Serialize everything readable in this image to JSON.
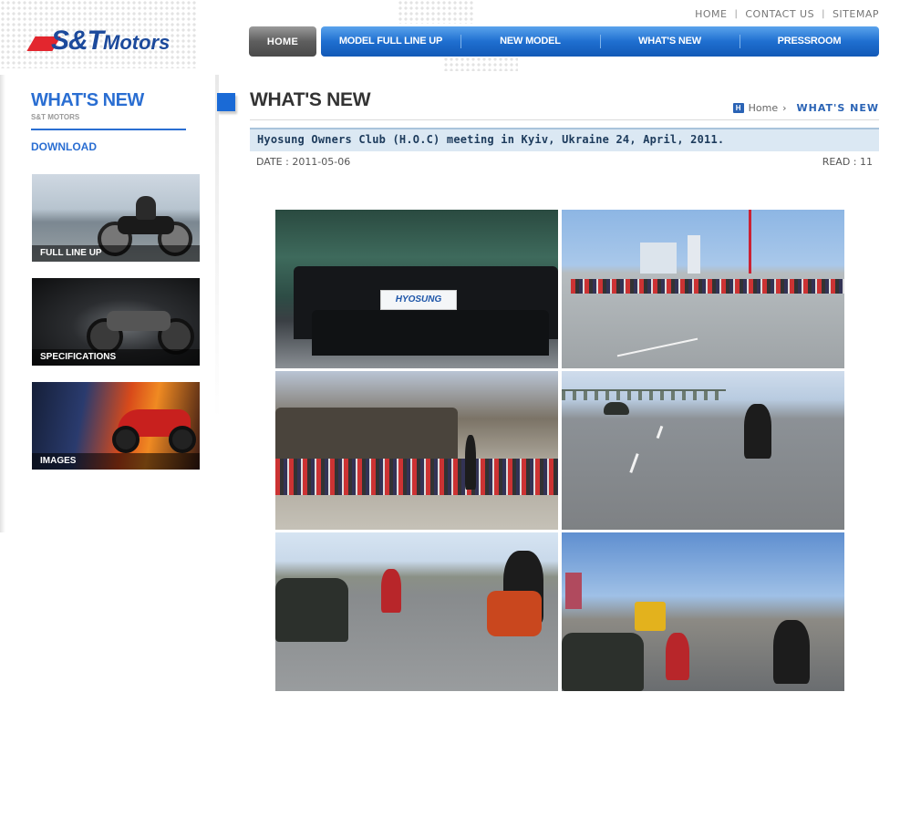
{
  "brand": {
    "name": "S&T",
    "suffix": "Motors"
  },
  "top_links": [
    "HOME",
    "CONTACT US",
    "SITEMAP"
  ],
  "nav": {
    "home": "HOME",
    "items": [
      "MODEL FULL LINE UP",
      "NEW MODEL",
      "WHAT'S NEW",
      "PRESSROOM"
    ]
  },
  "sidebar": {
    "title": "WHAT'S NEW",
    "subtitle": "S&T MOTORS",
    "download": "DOWNLOAD",
    "banners": [
      "FULL LINE UP",
      "SPECIFICATIONS",
      "IMAGES"
    ]
  },
  "main": {
    "title": "WHAT'S NEW",
    "breadcrumb": {
      "home": "Home",
      "current": "WHAT'S NEW"
    }
  },
  "post": {
    "title": "Hyosung Owners Club (H.O.C) meeting in Kyiv, Ukraine 24, April, 2011.",
    "date": "DATE : 2011-05-06",
    "read": "READ : 11",
    "banner_text": "HYOSUNG"
  },
  "colors": {
    "brand_blue": "#1c4a9c",
    "accent_red": "#e3262e",
    "nav_blue": "#1f6fd0"
  }
}
